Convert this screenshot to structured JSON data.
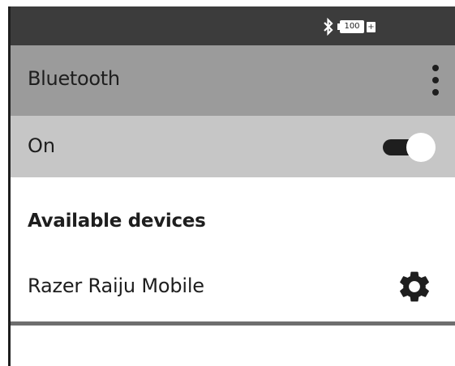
{
  "status_bar": {
    "bluetooth_icon": "bluetooth-icon",
    "battery_level": "100",
    "charging_indicator": "+"
  },
  "app_bar": {
    "title": "Bluetooth",
    "overflow_icon": "more-vertical-icon"
  },
  "toggle": {
    "label": "On",
    "state": "on"
  },
  "available": {
    "header": "Available devices",
    "devices": [
      {
        "name": "Razer Raiju Mobile",
        "settings_icon": "gear-icon"
      }
    ]
  },
  "colors": {
    "status_bar_bg": "#3c3c3c",
    "app_bar_bg": "#9b9b9b",
    "toggle_row_bg": "#c6c6c6",
    "text": "#1e1e1e",
    "switch_track_on": "#1e1e1e",
    "divider": "#6e6e6e"
  }
}
